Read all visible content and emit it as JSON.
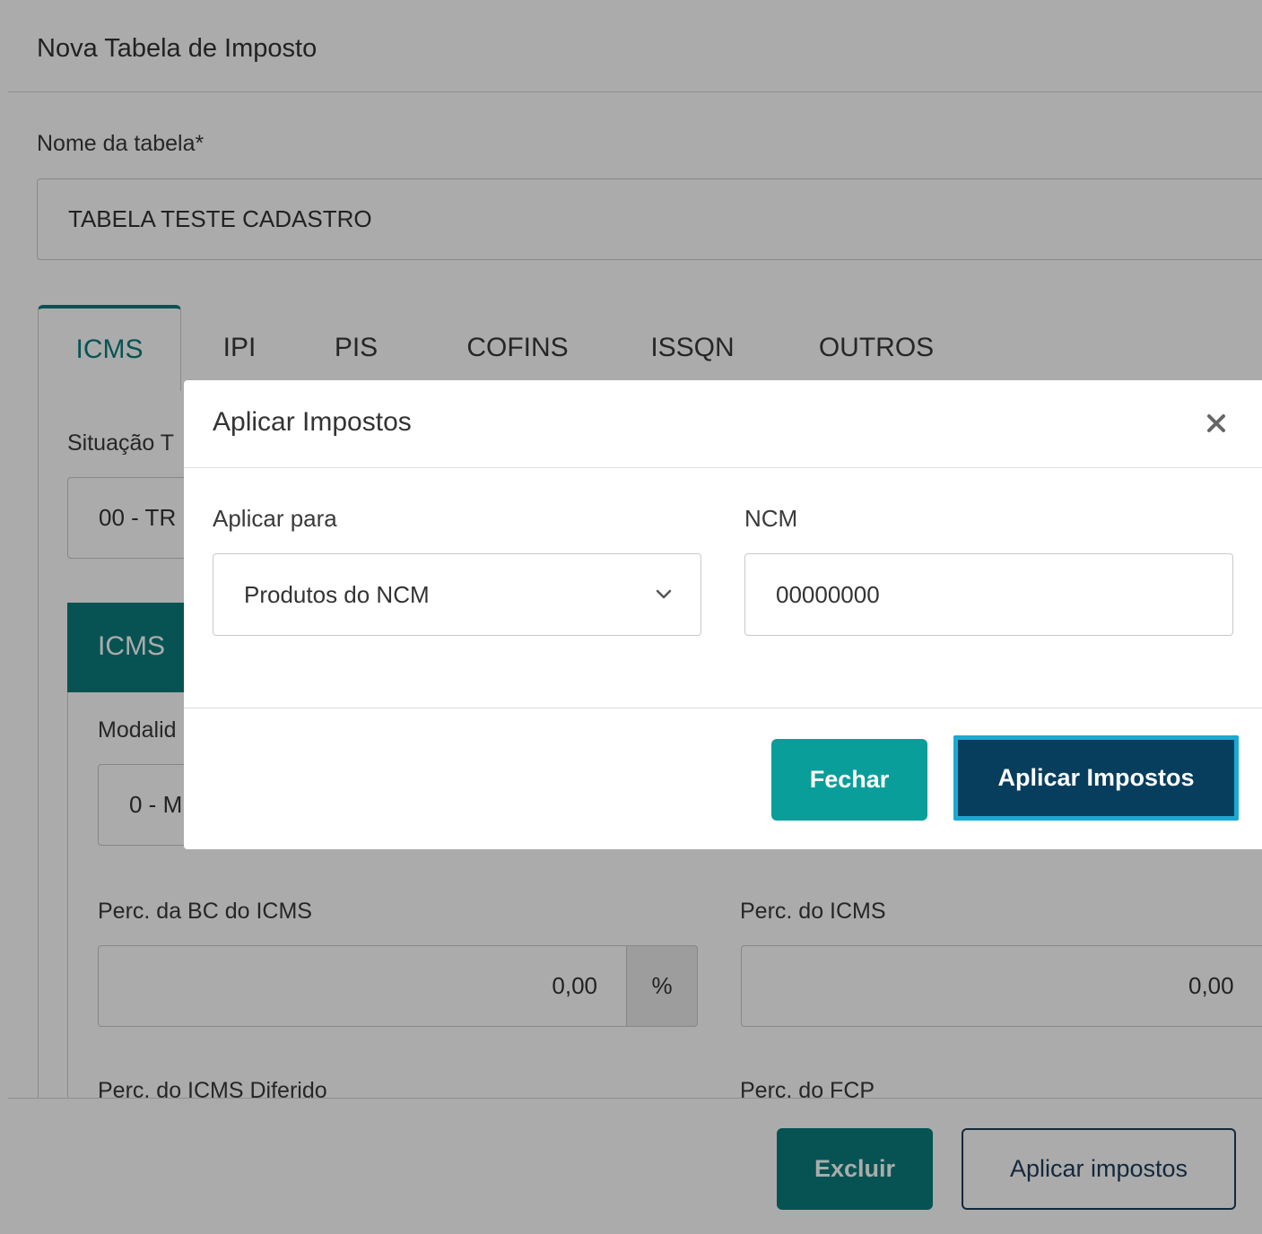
{
  "page": {
    "title": "Nova Tabela de Imposto",
    "table_name_label": "Nome da tabela*",
    "table_name_value": "TABELA TESTE CADASTRO"
  },
  "tabs": [
    {
      "label": "ICMS",
      "active": true
    },
    {
      "label": "IPI"
    },
    {
      "label": "PIS"
    },
    {
      "label": "COFINS"
    },
    {
      "label": "ISSQN"
    },
    {
      "label": "OUTROS"
    }
  ],
  "icms_tab": {
    "situacao_label": "Situação T",
    "situacao_value": "00 - TR",
    "panel_title": "ICMS",
    "modalidade_label": "Modalid",
    "modalidade_value": "0 - M",
    "perc_bc_label": "Perc. da BC do ICMS",
    "perc_bc_value": "0,00",
    "perc_bc_suffix": "%",
    "perc_icms_label": "Perc. do ICMS",
    "perc_icms_value": "0,00",
    "perc_diferido_label": "Perc. do ICMS Diferido",
    "perc_fcp_label": "Perc. do FCP"
  },
  "footer": {
    "delete_label": "Excluir",
    "apply_label": "Aplicar impostos"
  },
  "modal": {
    "title": "Aplicar Impostos",
    "apply_to_label": "Aplicar para",
    "apply_to_value": "Produtos do NCM",
    "ncm_label": "NCM",
    "ncm_value": "00000000",
    "close_label": "Fechar",
    "apply_button_label": "Aplicar Impostos"
  },
  "colors": {
    "teal": "#0b7d7d",
    "teal_light": "#0a9e9a",
    "navy": "#073e5e",
    "focus": "#1aa9d1"
  }
}
